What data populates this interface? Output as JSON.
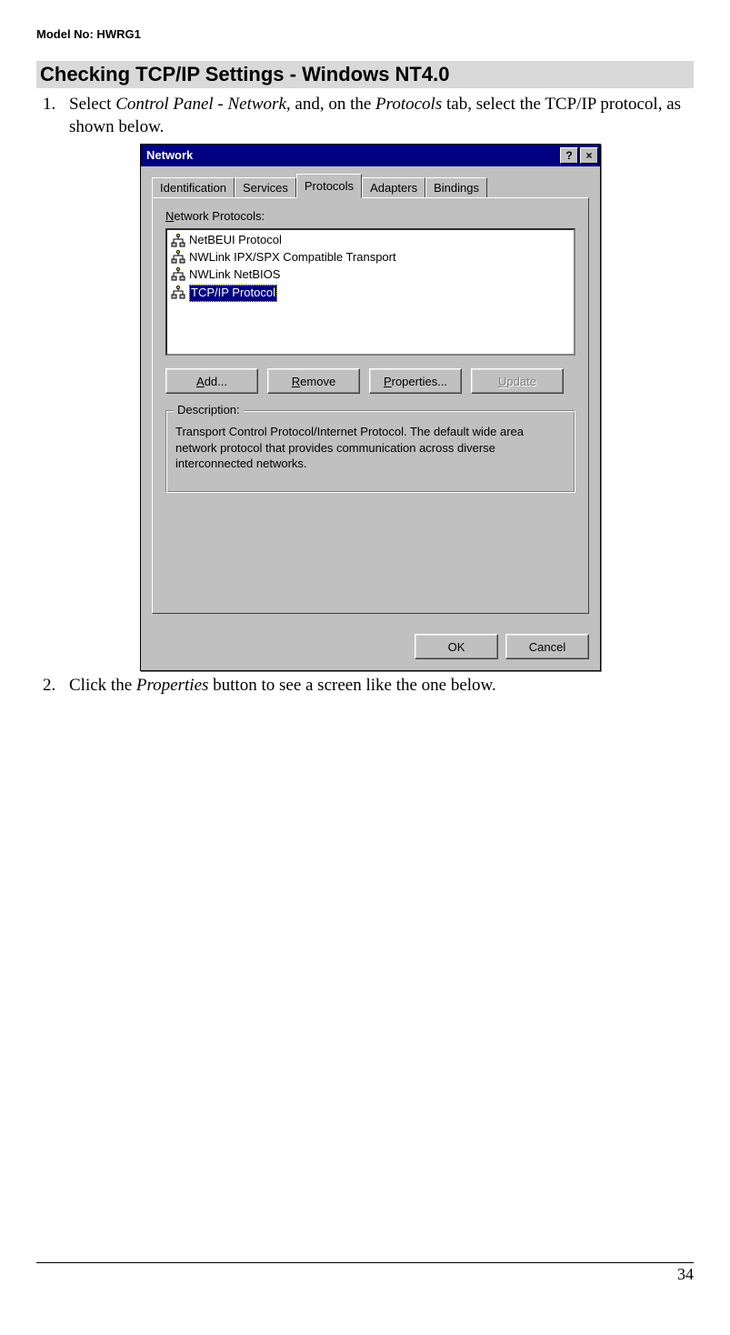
{
  "header": {
    "model": "Model No: HWRG1"
  },
  "section": {
    "heading": "Checking TCP/IP Settings - Windows NT4.0"
  },
  "steps": {
    "s1_a": "Select ",
    "s1_i1": "Control Panel - Network",
    "s1_b": ", and, on the ",
    "s1_i2": "Protocols",
    "s1_c": " tab, select the TCP/IP protocol, as shown below.",
    "s2_a": "Click the ",
    "s2_i1": "Properties",
    "s2_b": " button to see a screen like the one below."
  },
  "dialog": {
    "title": "Network",
    "help_glyph": "?",
    "close_glyph": "×",
    "tabs": {
      "identification": "Identification",
      "services": "Services",
      "protocols": "Protocols",
      "adapters": "Adapters",
      "bindings": "Bindings"
    },
    "list_label_pre": "N",
    "list_label_post": "etwork Protocols:",
    "protocols": {
      "p0": "NetBEUI Protocol",
      "p1": "NWLink IPX/SPX Compatible Transport",
      "p2": "NWLink NetBIOS",
      "p3": "TCP/IP Protocol"
    },
    "buttons": {
      "add_mn": "A",
      "add_rest": "dd...",
      "remove_mn": "R",
      "remove_rest": "emove",
      "props_mn": "P",
      "props_rest": "roperties...",
      "update_mn": "U",
      "update_rest": "pdate"
    },
    "desc_legend": "Description:",
    "desc_text": "Transport Control Protocol/Internet Protocol. The default wide area network protocol that provides communication across diverse interconnected networks.",
    "ok": "OK",
    "cancel": "Cancel"
  },
  "footer": {
    "page_number": "34"
  }
}
